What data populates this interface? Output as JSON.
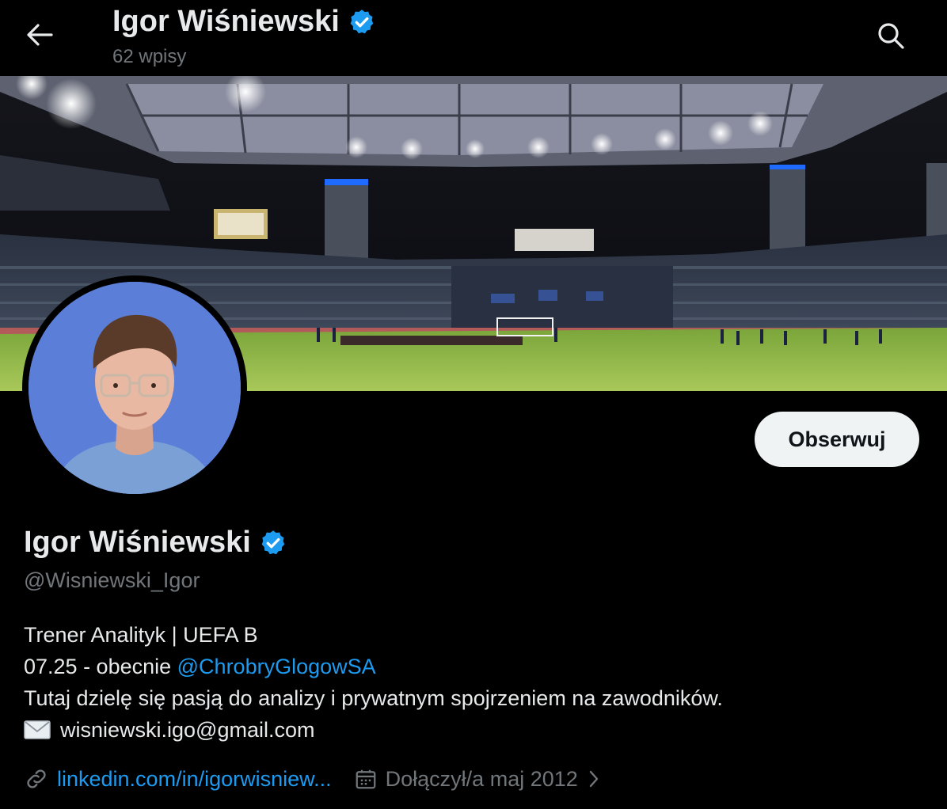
{
  "header": {
    "name": "Igor Wiśniewski",
    "posts_count": "62 wpisy"
  },
  "profile": {
    "display_name": "Igor Wiśniewski",
    "handle": "@Wisniewski_Igor",
    "follow_label": "Obserwuj",
    "bio": {
      "line1": "Trener Analityk | UEFA B",
      "line2_prefix": "07.25 - obecnie ",
      "line2_mention": "@ChrobryGlogowSA",
      "line3": "Tutaj dzielę się pasją do analizy i prywatnym spojrzeniem na zawodników.",
      "line4_email": "wisniewski.igo@gmail.com"
    },
    "website": "linkedin.com/in/igorwisniew...",
    "joined": "Dołączył/a maj 2012"
  },
  "colors": {
    "background": "#000000",
    "text_primary": "#e7e9ea",
    "text_secondary": "#71767b",
    "accent": "#1d9bf0",
    "button_bg": "#eff3f4",
    "avatar_bg": "#5b7fd9"
  },
  "icons": {
    "back": "arrow-left-icon",
    "search": "search-icon",
    "verified": "verified-badge-icon",
    "link": "link-icon",
    "calendar": "calendar-icon",
    "chevron": "chevron-right-icon",
    "email": "envelope-icon"
  }
}
